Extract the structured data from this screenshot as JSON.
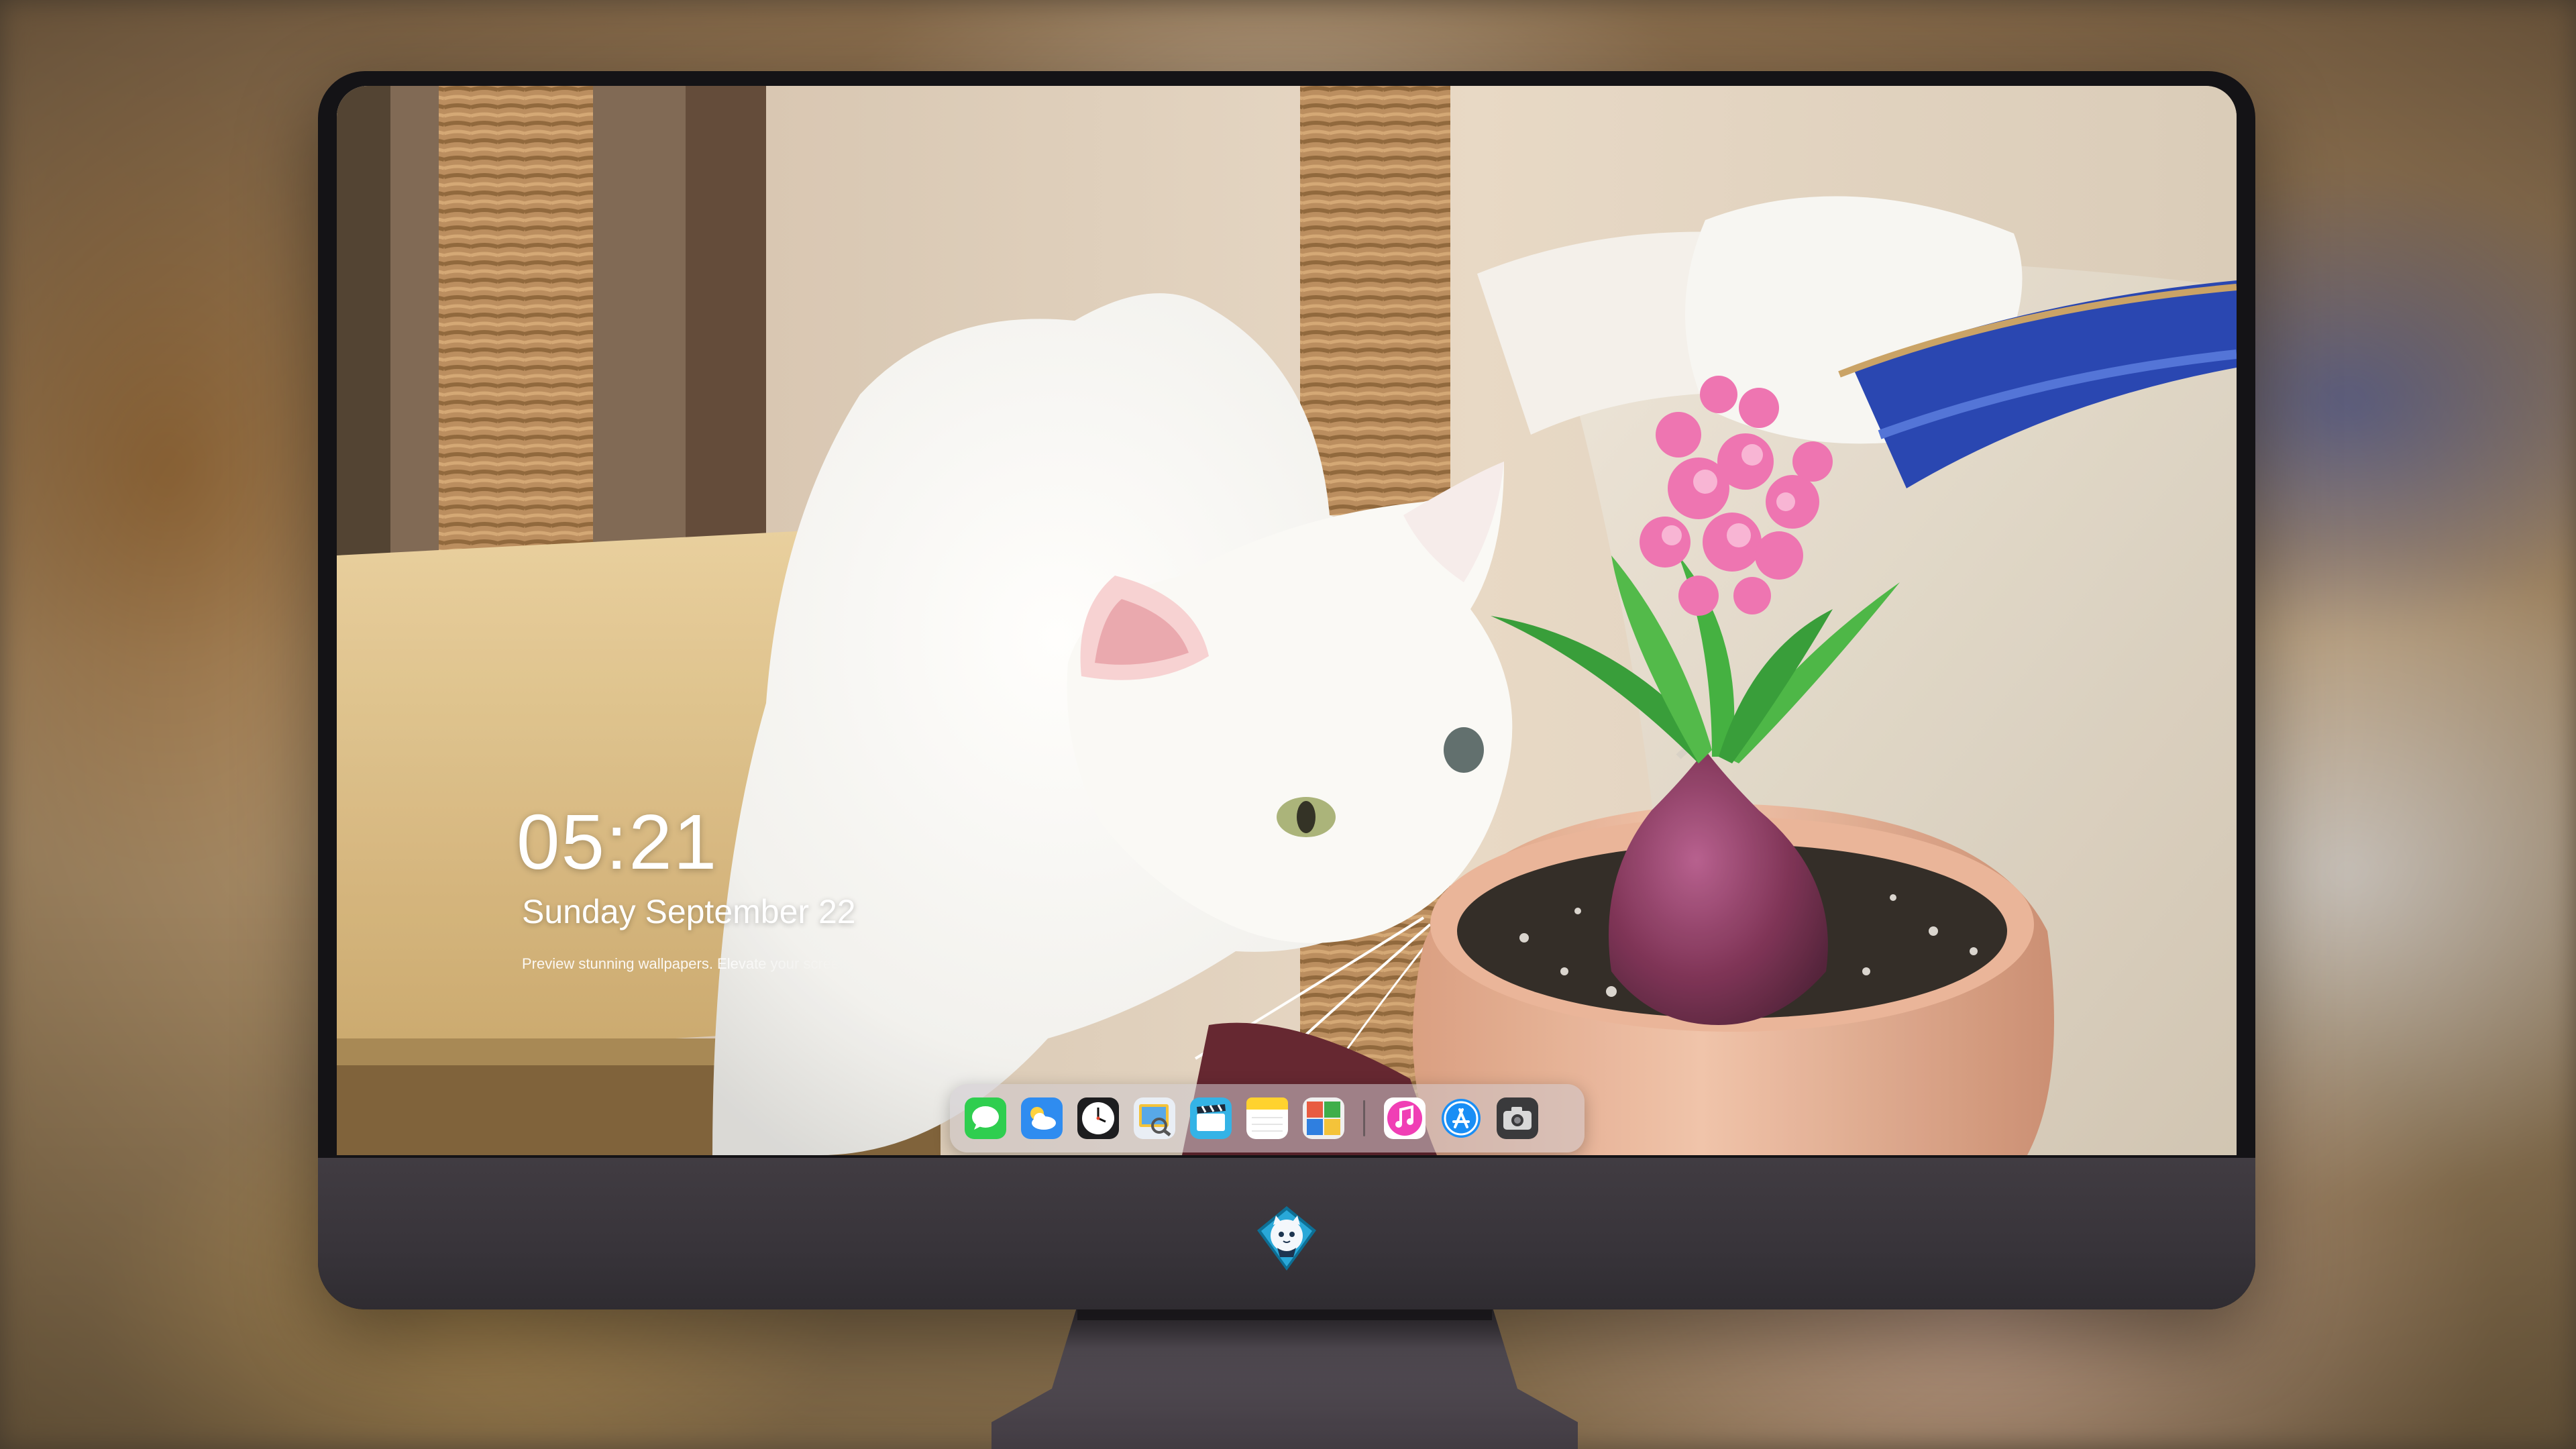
{
  "lockscreen": {
    "time": "05:21",
    "date": "Sunday September 22",
    "tagline": "Preview stunning wallpapers. Elevate your screen"
  },
  "dock": {
    "apps": [
      {
        "name": "messages",
        "icon": "message-bubble-icon",
        "color": "#2fce4f"
      },
      {
        "name": "weather",
        "icon": "weather-cloud-icon",
        "color": "#2f8cf0"
      },
      {
        "name": "clock",
        "icon": "clock-icon",
        "color": "#1d1d1f"
      },
      {
        "name": "preview",
        "icon": "preview-icon",
        "color": "#f4c33a"
      },
      {
        "name": "clips",
        "icon": "clapperboard-icon",
        "color": "#34b3e6"
      },
      {
        "name": "notes",
        "icon": "notes-icon",
        "color": "#ffd22e"
      },
      {
        "name": "photo-booth",
        "icon": "photo-booth-icon",
        "color": "#e85c41"
      },
      {
        "name": "music",
        "icon": "music-note-icon",
        "color": "#f03fb5"
      },
      {
        "name": "app-store",
        "icon": "app-store-icon",
        "color": "#1a8ef5"
      },
      {
        "name": "camera",
        "icon": "camera-icon",
        "color": "#3a3a3c"
      }
    ]
  },
  "monitor": {
    "badge_icon": "cat-mascot-icon",
    "body_color": "#141316",
    "chin_color": "#3c373d"
  },
  "colors": {
    "flower": "#ee6fb0",
    "leaves": "#3cae3a",
    "pot": "#e8b59a",
    "blanket": "#1e3fae"
  }
}
